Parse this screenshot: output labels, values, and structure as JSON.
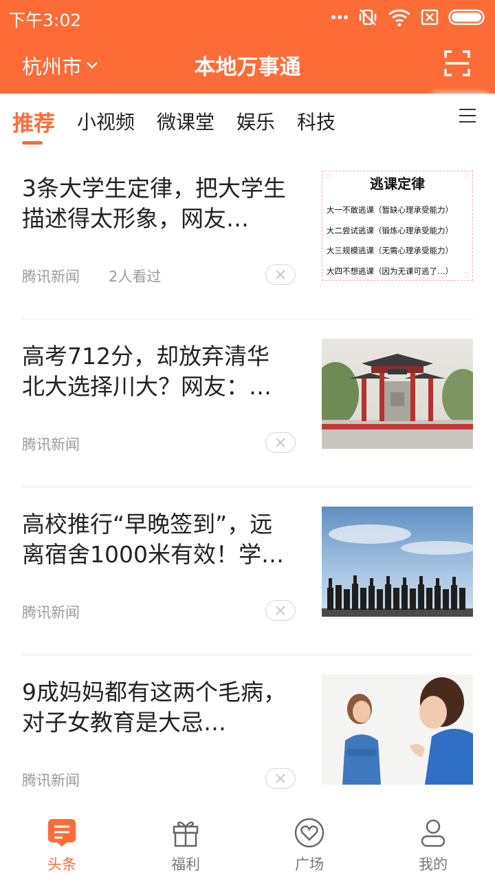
{
  "status": {
    "time": "下午3:02"
  },
  "header": {
    "city": "杭州市",
    "title": "本地万事通"
  },
  "tabs": [
    {
      "label": "推荐",
      "active": true
    },
    {
      "label": "小视频"
    },
    {
      "label": "微课堂"
    },
    {
      "label": "娱乐"
    },
    {
      "label": "科技"
    }
  ],
  "feed": [
    {
      "title": "3条大学生定律，把大学生描述得太形象，网友…",
      "source": "腾讯新闻",
      "views": "2人看过",
      "thumb": {
        "type": "text-card",
        "title": "逃课定律",
        "lines": [
          "大一不敢逃课（暂缺心理承受能力）",
          "大二尝试逃课（锻炼心理承受能力）",
          "大三规模逃课（无需心理承受能力）",
          "大四不想逃课（因为无课可逃了…）"
        ]
      }
    },
    {
      "title": "高考712分，却放弃清华北大选择川大？网友：…",
      "source": "腾讯新闻",
      "thumb": {
        "type": "photo-gate"
      }
    },
    {
      "title": "高校推行“早晚签到”，远离宿舍1000米有效！学…",
      "source": "腾讯新闻",
      "thumb": {
        "type": "photo-graduates"
      }
    },
    {
      "title": "9成妈妈都有这两个毛病，对子女教育是大忌…",
      "source": "腾讯新闻",
      "thumb": {
        "type": "photo-mother-child"
      }
    }
  ],
  "bottom_nav": [
    {
      "label": "头条",
      "icon": "headline-icon",
      "active": true
    },
    {
      "label": "福利",
      "icon": "gift-icon"
    },
    {
      "label": "广场",
      "icon": "heart-circle-icon"
    },
    {
      "label": "我的",
      "icon": "person-icon"
    }
  ],
  "colors": {
    "accent": "#fd6b36",
    "meta_text": "#9b9b9b",
    "divider": "#e8e8e8"
  }
}
